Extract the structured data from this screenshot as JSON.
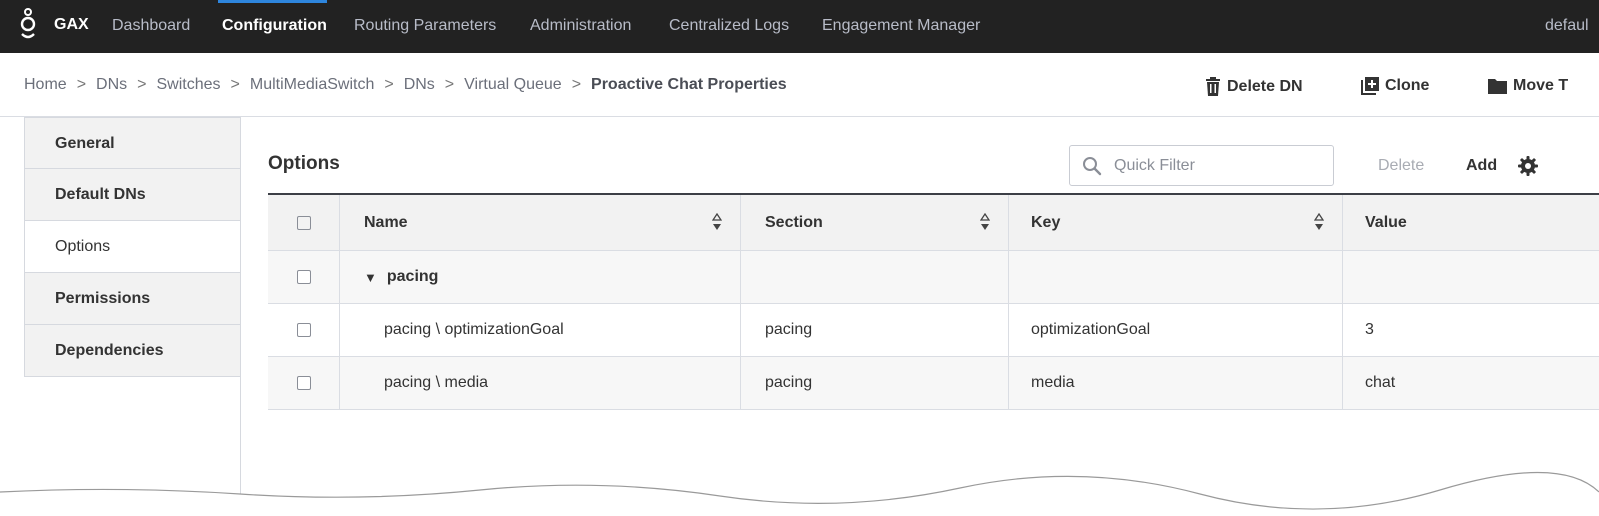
{
  "topbar": {
    "app_name": "GAX",
    "nav": [
      {
        "label": "Dashboard",
        "active": false
      },
      {
        "label": "Configuration",
        "active": true
      },
      {
        "label": "Routing Parameters",
        "active": false
      },
      {
        "label": "Administration",
        "active": false
      },
      {
        "label": "Centralized Logs",
        "active": false
      },
      {
        "label": "Engagement Manager",
        "active": false
      }
    ],
    "user": "defaul"
  },
  "breadcrumb": {
    "items": [
      "Home",
      "DNs",
      "Switches",
      "MultiMediaSwitch",
      "DNs",
      "Virtual Queue"
    ],
    "current": "Proactive Chat Properties"
  },
  "actions": {
    "delete": "Delete DN",
    "clone": "Clone",
    "move": "Move T"
  },
  "sidebar": {
    "tabs": [
      {
        "label": "General",
        "active": false
      },
      {
        "label": "Default DNs",
        "active": false
      },
      {
        "label": "Options",
        "active": true
      },
      {
        "label": "Permissions",
        "active": false
      },
      {
        "label": "Dependencies",
        "active": false
      }
    ]
  },
  "options": {
    "title": "Options",
    "filter_placeholder": "Quick Filter",
    "delete_label": "Delete",
    "add_label": "Add"
  },
  "table": {
    "headers": {
      "name": "Name",
      "section": "Section",
      "key": "Key",
      "value": "Value"
    },
    "group": "pacing",
    "rows": [
      {
        "name": "pacing \\ optimizationGoal",
        "section": "pacing",
        "key": "optimizationGoal",
        "value": "3"
      },
      {
        "name": "pacing \\ media",
        "section": "pacing",
        "key": "media",
        "value": "chat"
      }
    ]
  },
  "colors": {
    "topbar": "#222222",
    "accent": "#2e86de",
    "table_rule": "#3c3f46"
  }
}
